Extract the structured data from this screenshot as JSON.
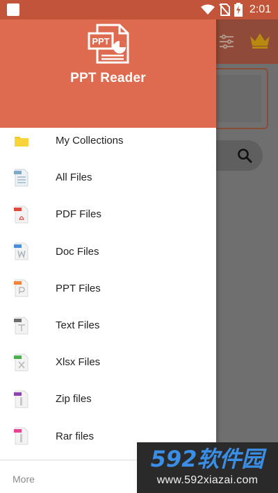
{
  "status_bar": {
    "time": "2:01",
    "icons": [
      "app-icon",
      "wifi-icon",
      "no-sim-icon",
      "battery-charging-icon"
    ]
  },
  "drawer": {
    "app_name": "PPT Reader",
    "logo": {
      "icon": "ppt-file-icon",
      "text": "PPT"
    },
    "menu_items": [
      {
        "label": "My Collections",
        "icon": "folder-icon",
        "color": "#f5c518"
      },
      {
        "label": "All Files",
        "icon": "all-files-icon",
        "color": "#7fa8c9"
      },
      {
        "label": "PDF Files",
        "icon": "pdf-file-icon",
        "color": "#e0483b"
      },
      {
        "label": "Doc Files",
        "icon": "doc-file-icon",
        "color": "#4a90d9"
      },
      {
        "label": "PPT Files",
        "icon": "ppt-file-icon",
        "color": "#f0843c"
      },
      {
        "label": "Text Files",
        "icon": "text-file-icon",
        "color": "#6d6d6d"
      },
      {
        "label": "Xlsx Files",
        "icon": "xlsx-file-icon",
        "color": "#4caf50"
      },
      {
        "label": "Zip files",
        "icon": "zip-file-icon",
        "color": "#8e44ad"
      },
      {
        "label": "Rar files",
        "icon": "rar-file-icon",
        "color": "#e84393"
      }
    ],
    "more_label": "More"
  },
  "background": {
    "icons": [
      "filter-icon",
      "crown-icon",
      "search-icon"
    ]
  },
  "watermark": {
    "logo_text": "592软件园",
    "url": "www.592xiazai.com"
  },
  "colors": {
    "header": "#de6a4f",
    "status_bar": "#c25539",
    "accent": "#de6a4f"
  }
}
